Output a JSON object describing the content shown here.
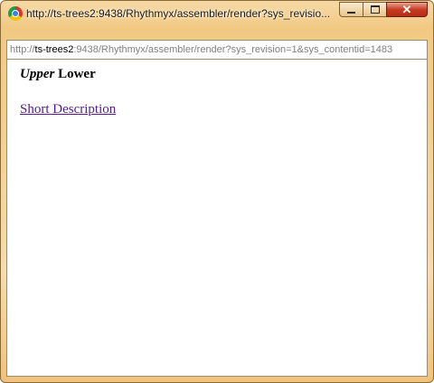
{
  "window": {
    "title": "http://ts-trees2:9438/Rhythmyx/assembler/render?sys_revisio..."
  },
  "address_bar": {
    "scheme": "http://",
    "host": "ts-trees2",
    "rest": ":9438/Rhythmyx/assembler/render?sys_revision=1&sys_contentid=1483"
  },
  "page": {
    "heading_italic": "Upper",
    "heading_rest": " Lower",
    "link_text": "Short Description"
  },
  "colors": {
    "frame": "#f1c983",
    "close_button": "#c73c22",
    "visited_link": "#551a8b"
  }
}
